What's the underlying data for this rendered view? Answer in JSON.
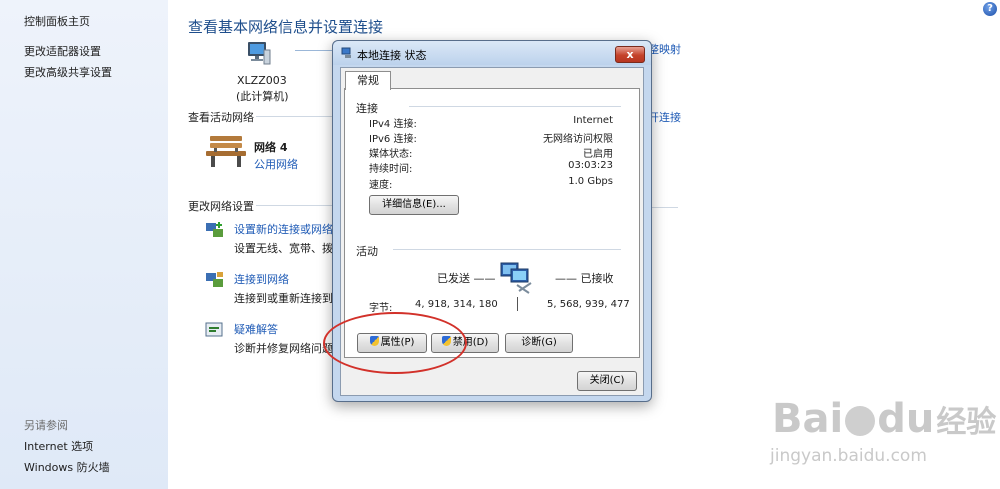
{
  "left_nav": {
    "home": "控制面板主页",
    "adapter_settings": "更改适配器设置",
    "advanced_sharing": "更改高级共享设置",
    "see_also_heading": "另请参阅",
    "internet_options": "Internet 选项",
    "firewall": "Windows 防火墙"
  },
  "main": {
    "title": "查看基本网络信息并设置连接",
    "full_map_fragment": "整映射",
    "computer_name": "XLZZ003",
    "computer_sub": "(此计算机)",
    "active_networks_heading": "查看活动网络",
    "connect_fragment": "开连接",
    "network_name": "网络 4",
    "network_type": "公用网络",
    "change_settings_heading": "更改网络设置",
    "items": [
      {
        "link": "设置新的连接或网络",
        "desc": "设置无线、宽带、拨号"
      },
      {
        "link": "连接到网络",
        "desc": "连接到或重新连接到无"
      },
      {
        "link": "疑难解答",
        "desc": "诊断并修复网络问题"
      }
    ]
  },
  "dialog": {
    "title": "本地连接 状态",
    "close_label": "x",
    "tab": "常规",
    "connection_heading": "连接",
    "rows": [
      {
        "label": "IPv4 连接:",
        "value": "Internet"
      },
      {
        "label": "IPv6 连接:",
        "value": "无网络访问权限"
      },
      {
        "label": "媒体状态:",
        "value": "已启用"
      },
      {
        "label": "持续时间:",
        "value": "03:03:23"
      },
      {
        "label": "速度:",
        "value": "1.0 Gbps"
      }
    ],
    "details_button": "详细信息(E)...",
    "activity_heading": "活动",
    "sent_label": "已发送 ——",
    "received_label": "—— 已接收",
    "bytes_label": "字节:",
    "bytes_sent": "4, 918, 314, 180",
    "bytes_received": "5, 568, 939, 477",
    "properties_button": "属性(P)",
    "disable_button": "禁用(D)",
    "diagnose_button": "诊断(G)",
    "close_button": "关闭(C)"
  },
  "watermark": {
    "brand": "Bai",
    "brand2": "du",
    "brand_cn": "经验",
    "url": "jingyan.baidu.com"
  },
  "help_label": "?"
}
